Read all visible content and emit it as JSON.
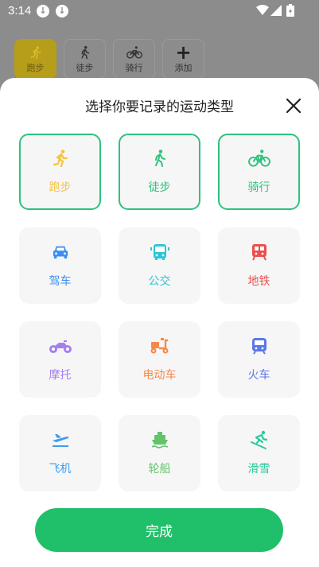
{
  "status_bar": {
    "time": "3:14"
  },
  "background": {
    "buttons": [
      {
        "label": "跑步",
        "icon": "running-icon",
        "active": true
      },
      {
        "label": "徒步",
        "icon": "walking-icon",
        "active": false
      },
      {
        "label": "骑行",
        "icon": "cycling-icon",
        "active": false
      },
      {
        "label": "添加",
        "icon": "plus-icon",
        "active": false
      }
    ]
  },
  "sheet": {
    "title": "选择你要记录的运动类型",
    "done_label": "完成",
    "colors": {
      "accent": "#2ec27e",
      "done_button": "#20c06a"
    },
    "items": [
      {
        "label": "跑步",
        "icon": "running-icon",
        "color": "#f5c242",
        "selected": true
      },
      {
        "label": "徒步",
        "icon": "walking-icon",
        "color": "#2ec27e",
        "selected": true
      },
      {
        "label": "骑行",
        "icon": "cycling-icon",
        "color": "#2ec27e",
        "selected": true
      },
      {
        "label": "驾车",
        "icon": "car-icon",
        "color": "#3b8ff0",
        "selected": false
      },
      {
        "label": "公交",
        "icon": "bus-icon",
        "color": "#29c7d6",
        "selected": false
      },
      {
        "label": "地铁",
        "icon": "subway-icon",
        "color": "#ec4f4f",
        "selected": false
      },
      {
        "label": "摩托",
        "icon": "motorcycle-icon",
        "color": "#a57ef0",
        "selected": false
      },
      {
        "label": "电动车",
        "icon": "scooter-icon",
        "color": "#f5894a",
        "selected": false
      },
      {
        "label": "火车",
        "icon": "train-icon",
        "color": "#5a78e8",
        "selected": false
      },
      {
        "label": "飞机",
        "icon": "airplane-icon",
        "color": "#3e9cf0",
        "selected": false
      },
      {
        "label": "轮船",
        "icon": "ship-icon",
        "color": "#62c46a",
        "selected": false
      },
      {
        "label": "滑雪",
        "icon": "skiing-icon",
        "color": "#2bc99a",
        "selected": false
      }
    ]
  }
}
